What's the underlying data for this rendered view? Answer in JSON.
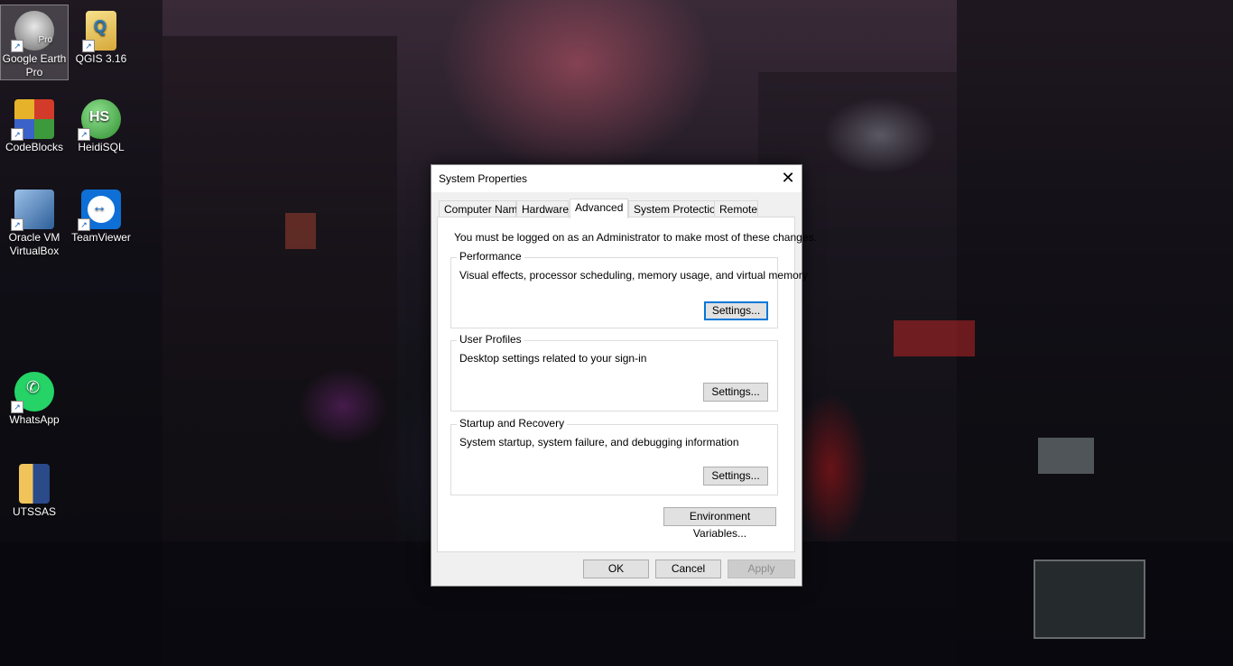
{
  "desktop": {
    "icons": [
      {
        "label": "Google Earth Pro",
        "icon": "google-earth-pro-icon",
        "color": "#8a8a8a"
      },
      {
        "label": "QGIS 3.16",
        "icon": "qgis-icon",
        "color": "#f2d35c"
      },
      {
        "label": "CodeBlocks",
        "icon": "codeblocks-icon",
        "color": "#c83232"
      },
      {
        "label": "HeidiSQL",
        "icon": "heidisql-icon",
        "color": "#3aa03a"
      },
      {
        "label": "Oracle VM VirtualBox",
        "icon": "virtualbox-icon",
        "color": "#4a7fb8"
      },
      {
        "label": "TeamViewer",
        "icon": "teamviewer-icon",
        "color": "#0e6fd6"
      },
      {
        "label": "WhatsApp",
        "icon": "whatsapp-icon",
        "color": "#25d366"
      },
      {
        "label": "UTSSAS",
        "icon": "folder-icon",
        "color": "#e8b84a"
      }
    ],
    "heidisql_badge": "HS",
    "google_earth_badge": "Pro"
  },
  "dialog": {
    "title": "System Properties",
    "close_glyph": "✕",
    "tabs": [
      "Computer Name",
      "Hardware",
      "Advanced",
      "System Protection",
      "Remote"
    ],
    "active_tab": "Advanced",
    "note": "You must be logged on as an Administrator to make most of these changes.",
    "groups": [
      {
        "title": "Performance",
        "description": "Visual effects, processor scheduling, memory usage, and virtual memory",
        "button": "Settings..."
      },
      {
        "title": "User Profiles",
        "description": "Desktop settings related to your sign-in",
        "button": "Settings..."
      },
      {
        "title": "Startup and Recovery",
        "description": "System startup, system failure, and debugging information",
        "button": "Settings..."
      }
    ],
    "env_button": "Environment Variables...",
    "ok": "OK",
    "cancel": "Cancel",
    "apply": "Apply"
  },
  "colors": {
    "accent": "#0078d7"
  }
}
